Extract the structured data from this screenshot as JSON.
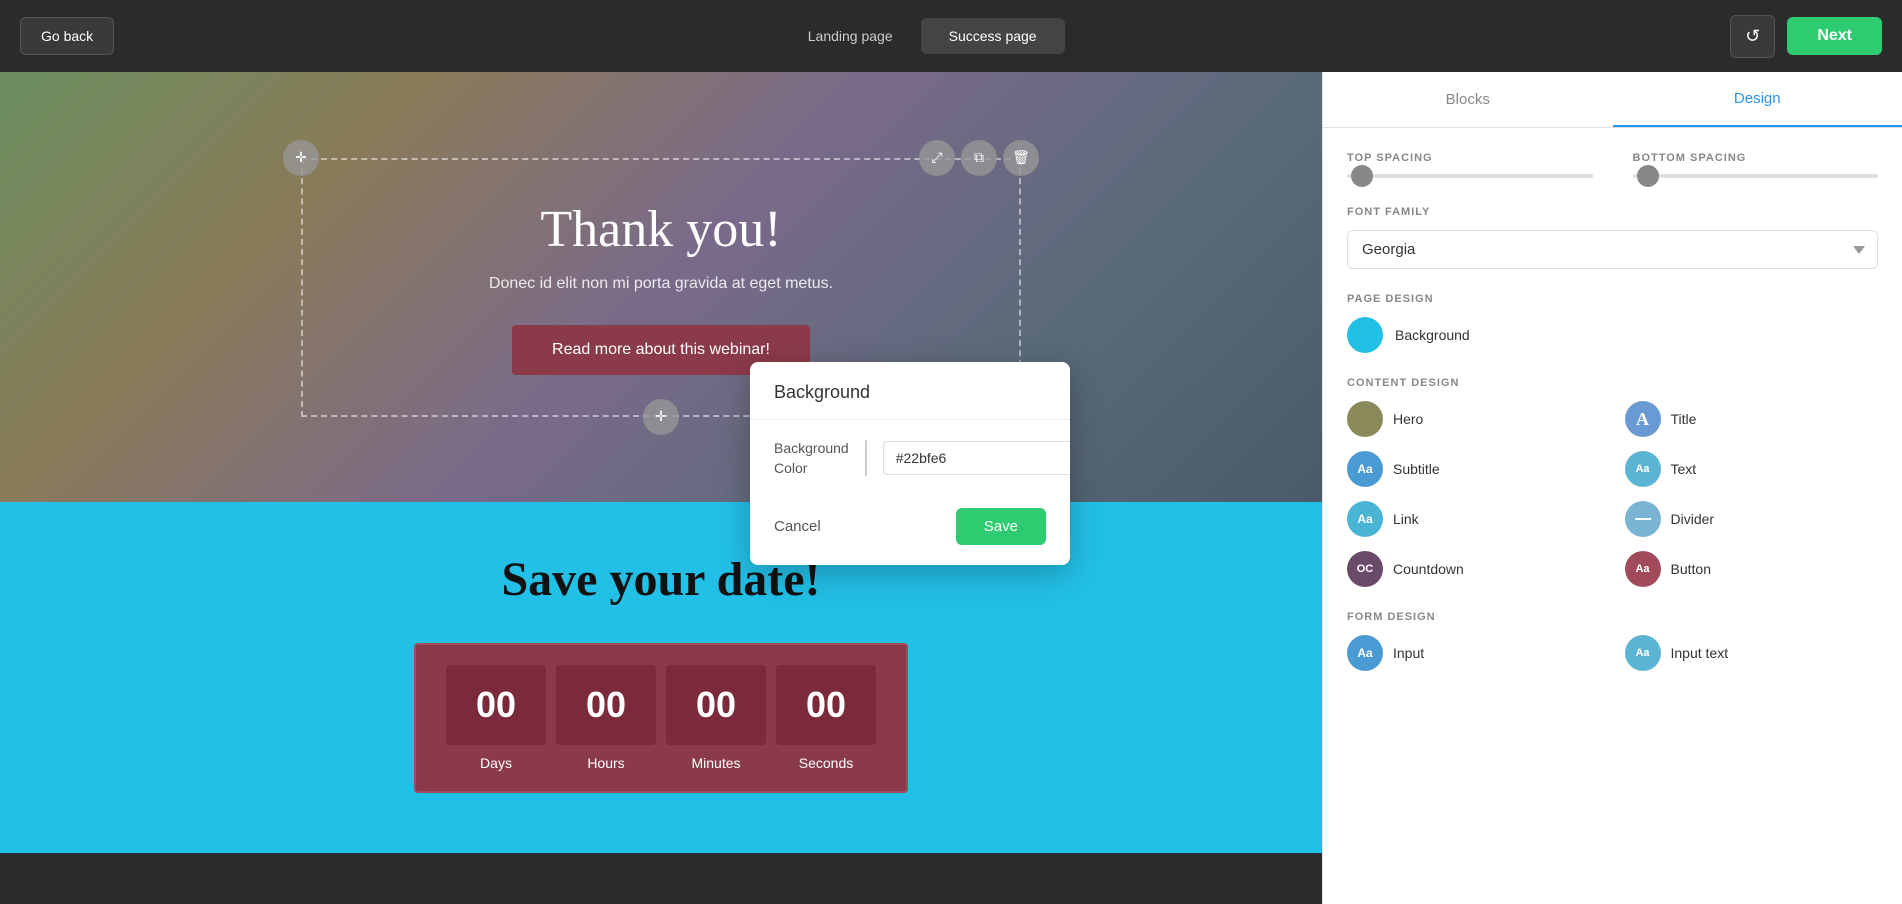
{
  "topbar": {
    "go_back_label": "Go back",
    "landing_tab_label": "Landing page",
    "success_tab_label": "Success page",
    "history_icon": "↺",
    "next_label": "Next"
  },
  "hero": {
    "title": "Thank you!",
    "subtitle": "Donec id elit non mi porta gravida at eget metus.",
    "button_label": "Read more about this webinar!"
  },
  "countdown_section": {
    "title": "Save your date!",
    "units": [
      {
        "value": "00",
        "label": "Days"
      },
      {
        "value": "00",
        "label": "Hours"
      },
      {
        "value": "00",
        "label": "Minutes"
      },
      {
        "value": "00",
        "label": "Seconds"
      }
    ]
  },
  "bg_popup": {
    "title": "Background",
    "color_label": "Background\nColor",
    "color_value": "#22bfe6",
    "cancel_label": "Cancel",
    "save_label": "Save"
  },
  "right_panel": {
    "tabs": [
      {
        "id": "blocks",
        "label": "Blocks"
      },
      {
        "id": "design",
        "label": "Design"
      }
    ],
    "active_tab": "design",
    "top_spacing_label": "TOP SPACING",
    "bottom_spacing_label": "BOTTOM SPACING",
    "font_family_label": "FONT FAMILY",
    "font_family_value": "Georgia",
    "page_design_label": "PAGE DESIGN",
    "page_design_items": [
      {
        "id": "background",
        "label": "Background",
        "color": "#22bfe6"
      }
    ],
    "content_design_label": "CONTENT DESIGN",
    "content_design_items": [
      {
        "id": "hero",
        "label": "Hero",
        "avatar_text": "",
        "avatar_class": "avatar-hero"
      },
      {
        "id": "title",
        "label": "Title",
        "avatar_text": "A",
        "avatar_class": "avatar-title"
      },
      {
        "id": "subtitle",
        "label": "Subtitle",
        "avatar_text": "Aa",
        "avatar_class": "avatar-subtitle"
      },
      {
        "id": "text",
        "label": "Text",
        "avatar_text": "Aa",
        "avatar_class": "avatar-text"
      },
      {
        "id": "link",
        "label": "Link",
        "avatar_text": "Aa",
        "avatar_class": "avatar-link"
      },
      {
        "id": "divider",
        "label": "Divider",
        "avatar_text": "—",
        "avatar_class": "avatar-divider"
      },
      {
        "id": "countdown",
        "label": "Countdown",
        "avatar_text": "OC",
        "avatar_class": "avatar-countdown"
      },
      {
        "id": "button",
        "label": "Button",
        "avatar_text": "Aa",
        "avatar_class": "avatar-button"
      }
    ],
    "form_design_label": "FORM DESIGN",
    "form_design_items": [
      {
        "id": "input",
        "label": "Input",
        "avatar_text": "Aa",
        "avatar_class": "avatar-subtitle"
      },
      {
        "id": "input-text",
        "label": "Input text",
        "avatar_text": "Aa",
        "avatar_class": "avatar-text"
      }
    ]
  }
}
